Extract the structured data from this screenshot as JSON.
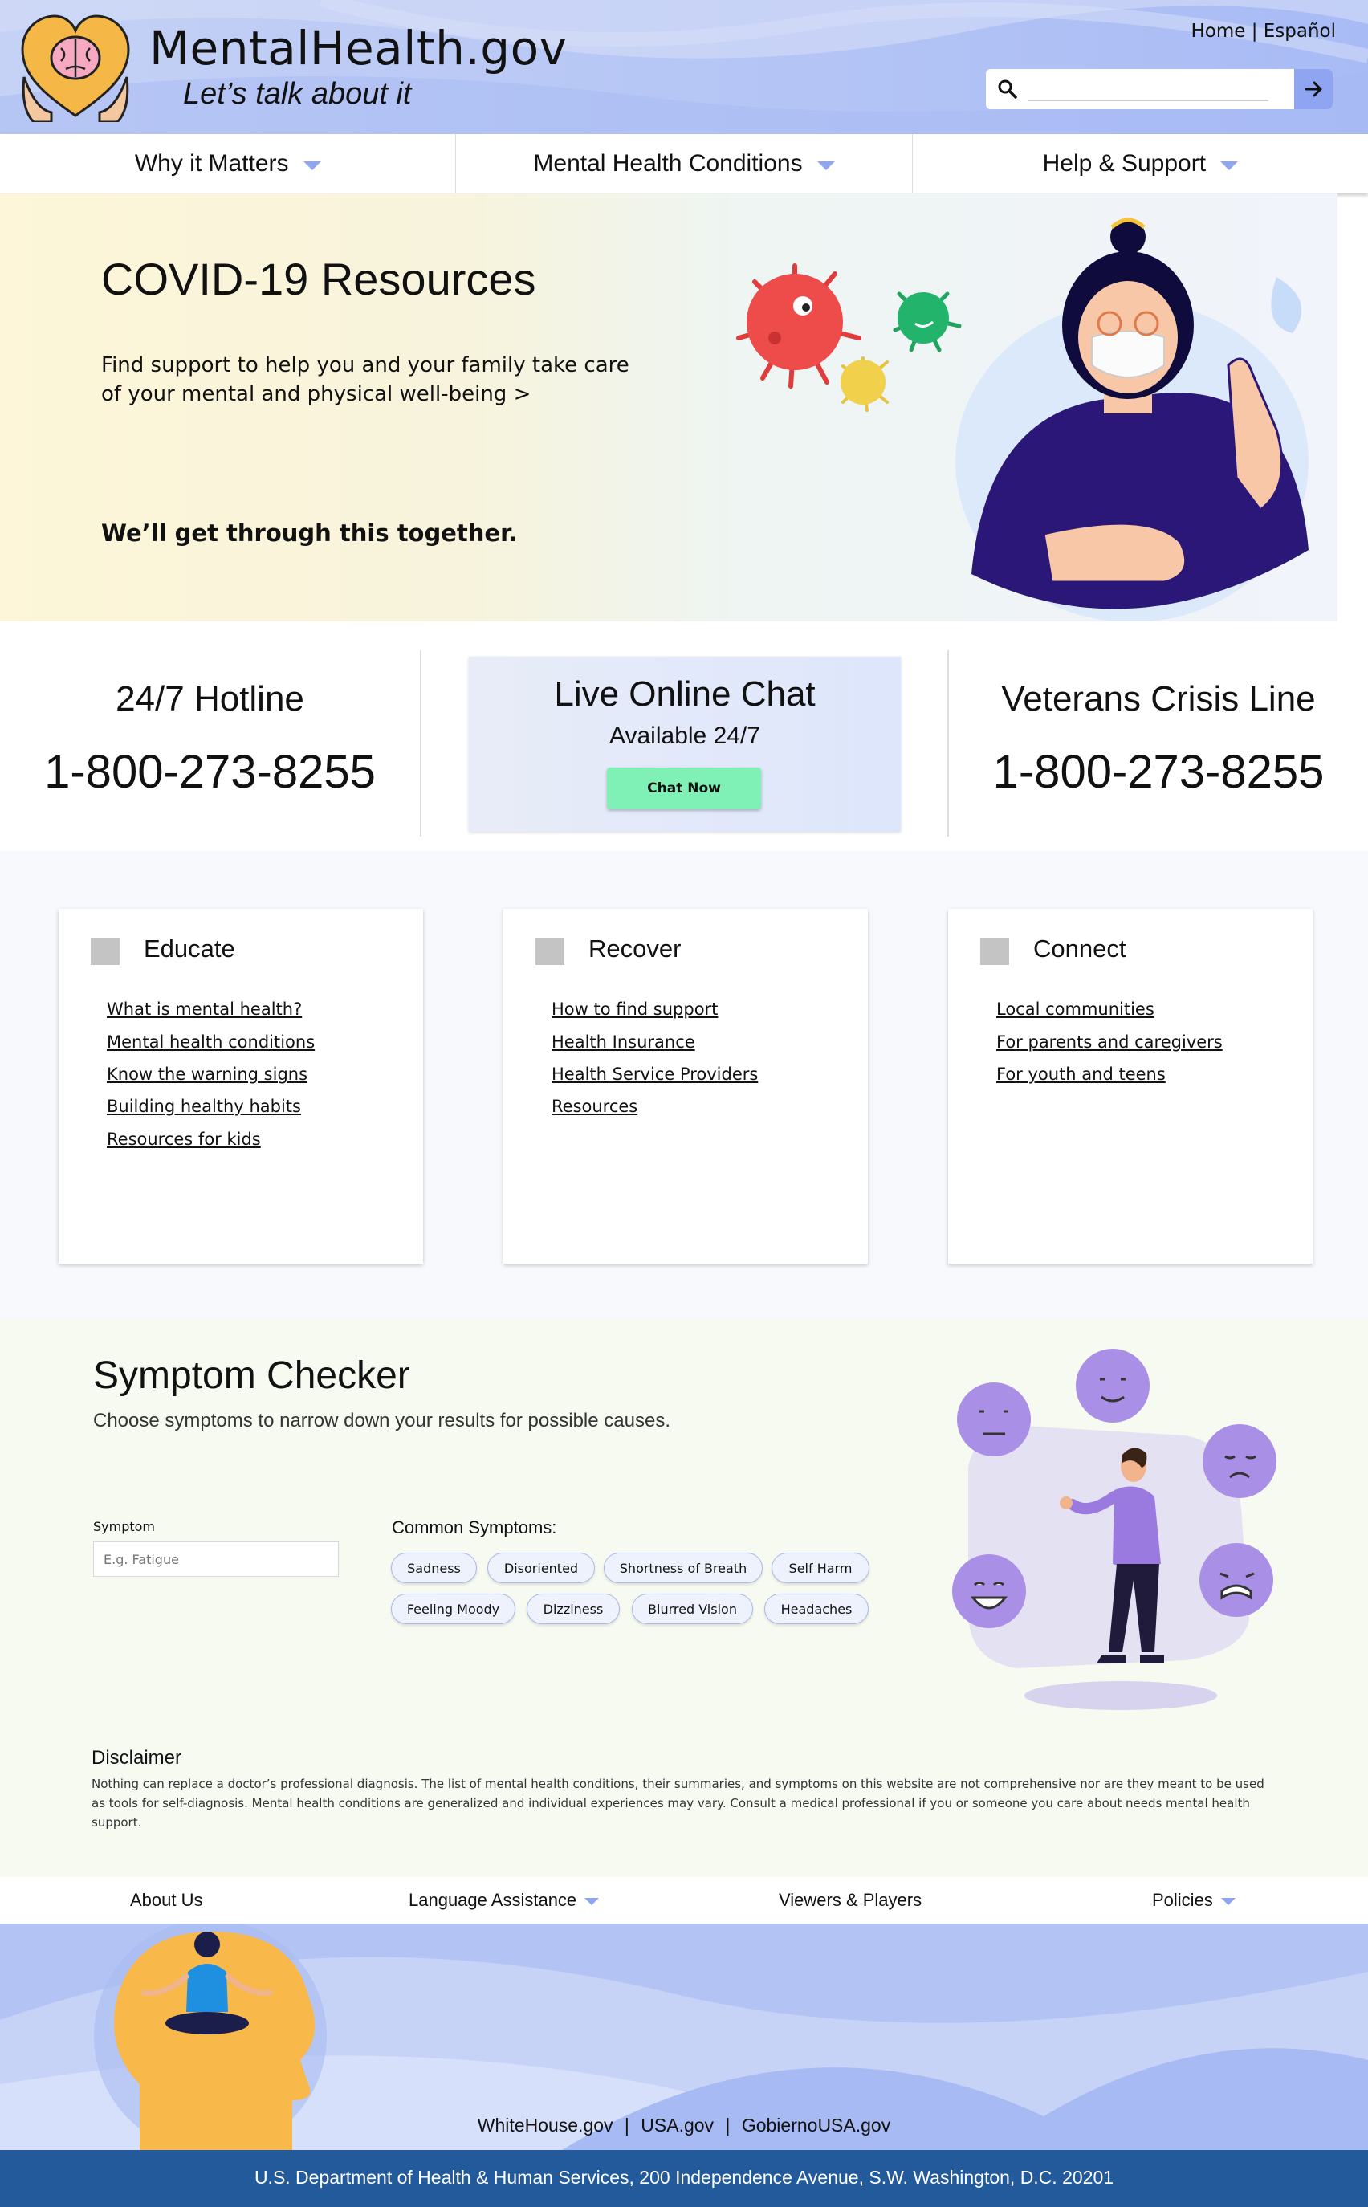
{
  "header": {
    "title": "MentalHealth.gov",
    "tagline": "Let’s talk about it",
    "util_home": "Home",
    "util_sep": "|",
    "util_espanol": "Español",
    "search_placeholder": ""
  },
  "nav": [
    {
      "label": "Why it Matters"
    },
    {
      "label": "Mental Health Conditions"
    },
    {
      "label": "Help & Support"
    }
  ],
  "hero": {
    "title": "COVID-19 Resources",
    "description": "Find support to help you and your family take care of your mental and physical well-being  >",
    "tagline": "We’ll get through this together."
  },
  "contact": {
    "hotline_label": "24/7 Hotline",
    "hotline_number": "1-800-273-8255",
    "chat_title": "Live Online Chat",
    "chat_subtitle": "Available 24/7",
    "chat_button": "Chat Now",
    "veterans_label": "Veterans Crisis Line",
    "veterans_number": "1-800-273-8255"
  },
  "cards": [
    {
      "title": "Educate",
      "links": [
        "What is mental health?",
        "Mental health conditions",
        "Know the warning signs",
        "Building healthy habits",
        "Resources for kids"
      ]
    },
    {
      "title": "Recover",
      "links": [
        "How to find support",
        "Health Insurance",
        "Health Service Providers",
        "Resources"
      ]
    },
    {
      "title": "Connect",
      "links": [
        "Local communities",
        "For parents and caregivers",
        "For youth and teens"
      ]
    }
  ],
  "symptom": {
    "title": "Symptom Checker",
    "description": "Choose symptoms to narrow down your results for possible causes.",
    "input_label": "Symptom",
    "input_placeholder": "E.g. Fatigue",
    "common_label": "Common Symptoms:",
    "chips": [
      "Sadness",
      "Disoriented",
      "Shortness of Breath",
      "Self Harm",
      "Feeling Moody",
      "Dizziness",
      "Blurred Vision",
      "Headaches"
    ]
  },
  "disclaimer": {
    "title": "Disclaimer",
    "text": "Nothing can replace a doctor’s professional diagnosis. The list of mental health conditions, their summaries, and symptoms on this website are not comprehensive nor are they meant to be used as tools for self-diagnosis. Mental health conditions are generalized and individual experiences may vary. Consult a medical professional if you or someone you care about needs mental health support."
  },
  "footer_nav": {
    "about": "About Us",
    "language": "Language Assistance",
    "viewers": "Viewers & Players",
    "policies": "Policies"
  },
  "footer": {
    "links": [
      "WhiteHouse.gov",
      "USA.gov",
      "GobiernoUSA.gov"
    ],
    "sep": "|",
    "address": "U.S. Department of Health & Human Services, 200 Independence Avenue, S.W. Washington, D.C. 20201"
  },
  "colors": {
    "accent": "#8fa5f2",
    "chat_button": "#7ff0b6",
    "footer_bottom": "#235a9b"
  }
}
